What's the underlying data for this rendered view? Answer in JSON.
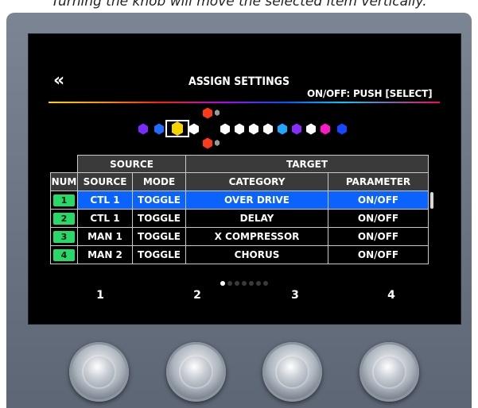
{
  "caption": "Turning the knob will move the selected item vertically.",
  "header": {
    "back_label": "«",
    "title": "ASSIGN SETTINGS",
    "hint": "ON/OFF: PUSH [SELECT]"
  },
  "table": {
    "group_headers": {
      "source": "SOURCE",
      "target": "TARGET"
    },
    "column_headers": [
      "NUM",
      "SOURCE",
      "MODE",
      "CATEGORY",
      "PARAMETER"
    ],
    "rows": [
      {
        "num": "1",
        "source": "CTL 1",
        "mode": "TOGGLE",
        "category": "OVER DRIVE",
        "parameter": "ON/OFF",
        "selected": true
      },
      {
        "num": "2",
        "source": "CTL 1",
        "mode": "TOGGLE",
        "category": "DELAY",
        "parameter": "ON/OFF",
        "selected": false
      },
      {
        "num": "3",
        "source": "MAN 1",
        "mode": "TOGGLE",
        "category": "X COMPRESSOR",
        "parameter": "ON/OFF",
        "selected": false
      },
      {
        "num": "4",
        "source": "MAN 2",
        "mode": "TOGGLE",
        "category": "CHORUS",
        "parameter": "ON/OFF",
        "selected": false
      }
    ]
  },
  "pagination": {
    "total": 7,
    "current": 1
  },
  "knob_labels": [
    "1",
    "2",
    "3",
    "4"
  ],
  "colors": {
    "selected_row": "#0a62ff",
    "num_badge": "#28d96a",
    "screen_bg": "#000000",
    "device_body": "#6b7583"
  },
  "effect_chain_icons": [
    "purple-hex",
    "blue-hex",
    "yellow-selected-hex",
    "white-hex",
    "red-hex-top",
    "gray-hex-bottom",
    "white-hex",
    "white-hex",
    "white-hex",
    "cyan-hex",
    "purple-hex",
    "white-hex",
    "magenta-hex",
    "blue-hex"
  ]
}
